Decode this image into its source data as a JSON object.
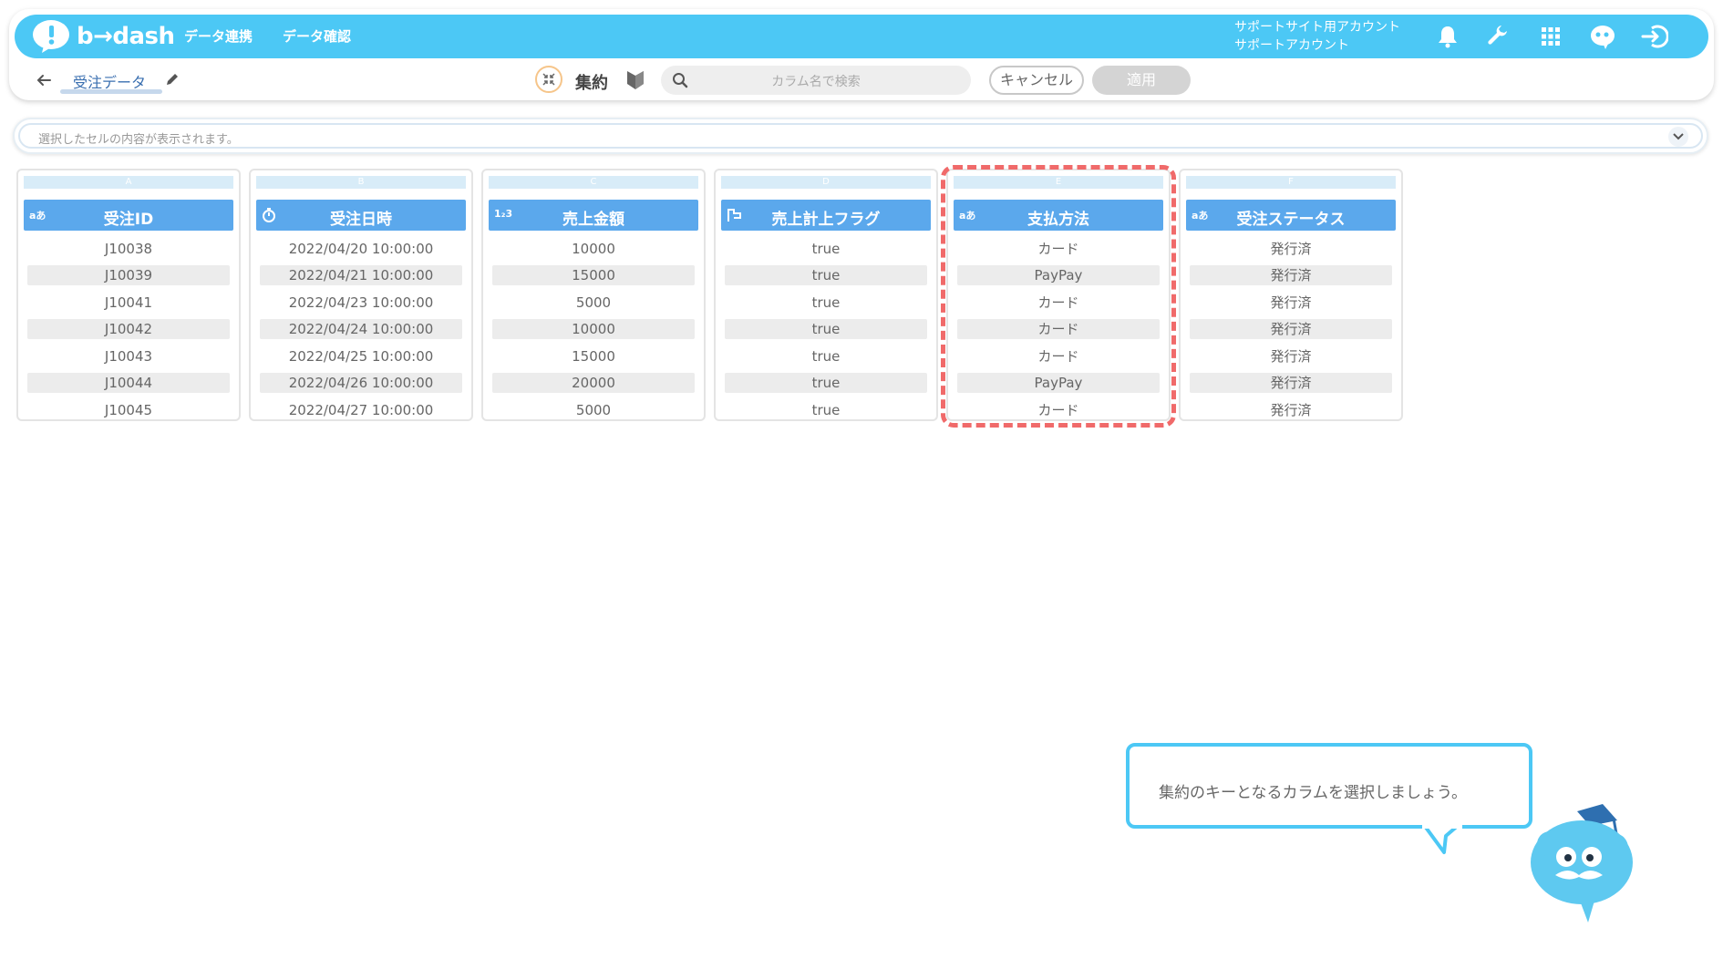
{
  "app": {
    "logo_text": "b→dash",
    "nav": [
      "データ連携",
      "データ確認"
    ],
    "account_line1": "サポートサイト用アカウント",
    "account_line2": "サポートアカウント"
  },
  "toolbar": {
    "title": "受注データ",
    "mode_label": "集約",
    "search_placeholder": "カラム名で検索",
    "cancel_label": "キャンセル",
    "apply_label": "適用"
  },
  "cell_bar": {
    "placeholder": "選択したセルの内容が表示されます。"
  },
  "columns": [
    {
      "letter": "A",
      "type": "aあ",
      "name": "受注ID",
      "cells": [
        "J10038",
        "J10039",
        "J10041",
        "J10042",
        "J10043",
        "J10044",
        "J10045"
      ]
    },
    {
      "letter": "B",
      "type": "clock",
      "name": "受注日時",
      "cells": [
        "2022/04/20 10:00:00",
        "2022/04/21 10:00:00",
        "2022/04/23 10:00:00",
        "2022/04/24 10:00:00",
        "2022/04/25 10:00:00",
        "2022/04/26 10:00:00",
        "2022/04/27 10:00:00"
      ]
    },
    {
      "letter": "C",
      "type": "123",
      "name": "売上金額",
      "cells": [
        "10000",
        "15000",
        "5000",
        "10000",
        "15000",
        "20000",
        "5000"
      ]
    },
    {
      "letter": "D",
      "type": "flag",
      "name": "売上計上フラグ",
      "cells": [
        "true",
        "true",
        "true",
        "true",
        "true",
        "true",
        "true"
      ]
    },
    {
      "letter": "E",
      "type": "aあ",
      "name": "支払方法",
      "cells": [
        "カード",
        "PayPay",
        "カード",
        "カード",
        "カード",
        "PayPay",
        "カード"
      ]
    },
    {
      "letter": "F",
      "type": "aあ",
      "name": "受注ステータス",
      "cells": [
        "発行済",
        "発行済",
        "発行済",
        "発行済",
        "発行済",
        "発行済",
        "発行済"
      ]
    }
  ],
  "tooltip": {
    "text": "集約のキーとなるカラムを選択しましょう。"
  },
  "colors": {
    "brand": "#4cc8f5",
    "column_header": "#5ba8ec",
    "highlight": "#f06a6a",
    "agg_ring": "#f6c58a"
  }
}
